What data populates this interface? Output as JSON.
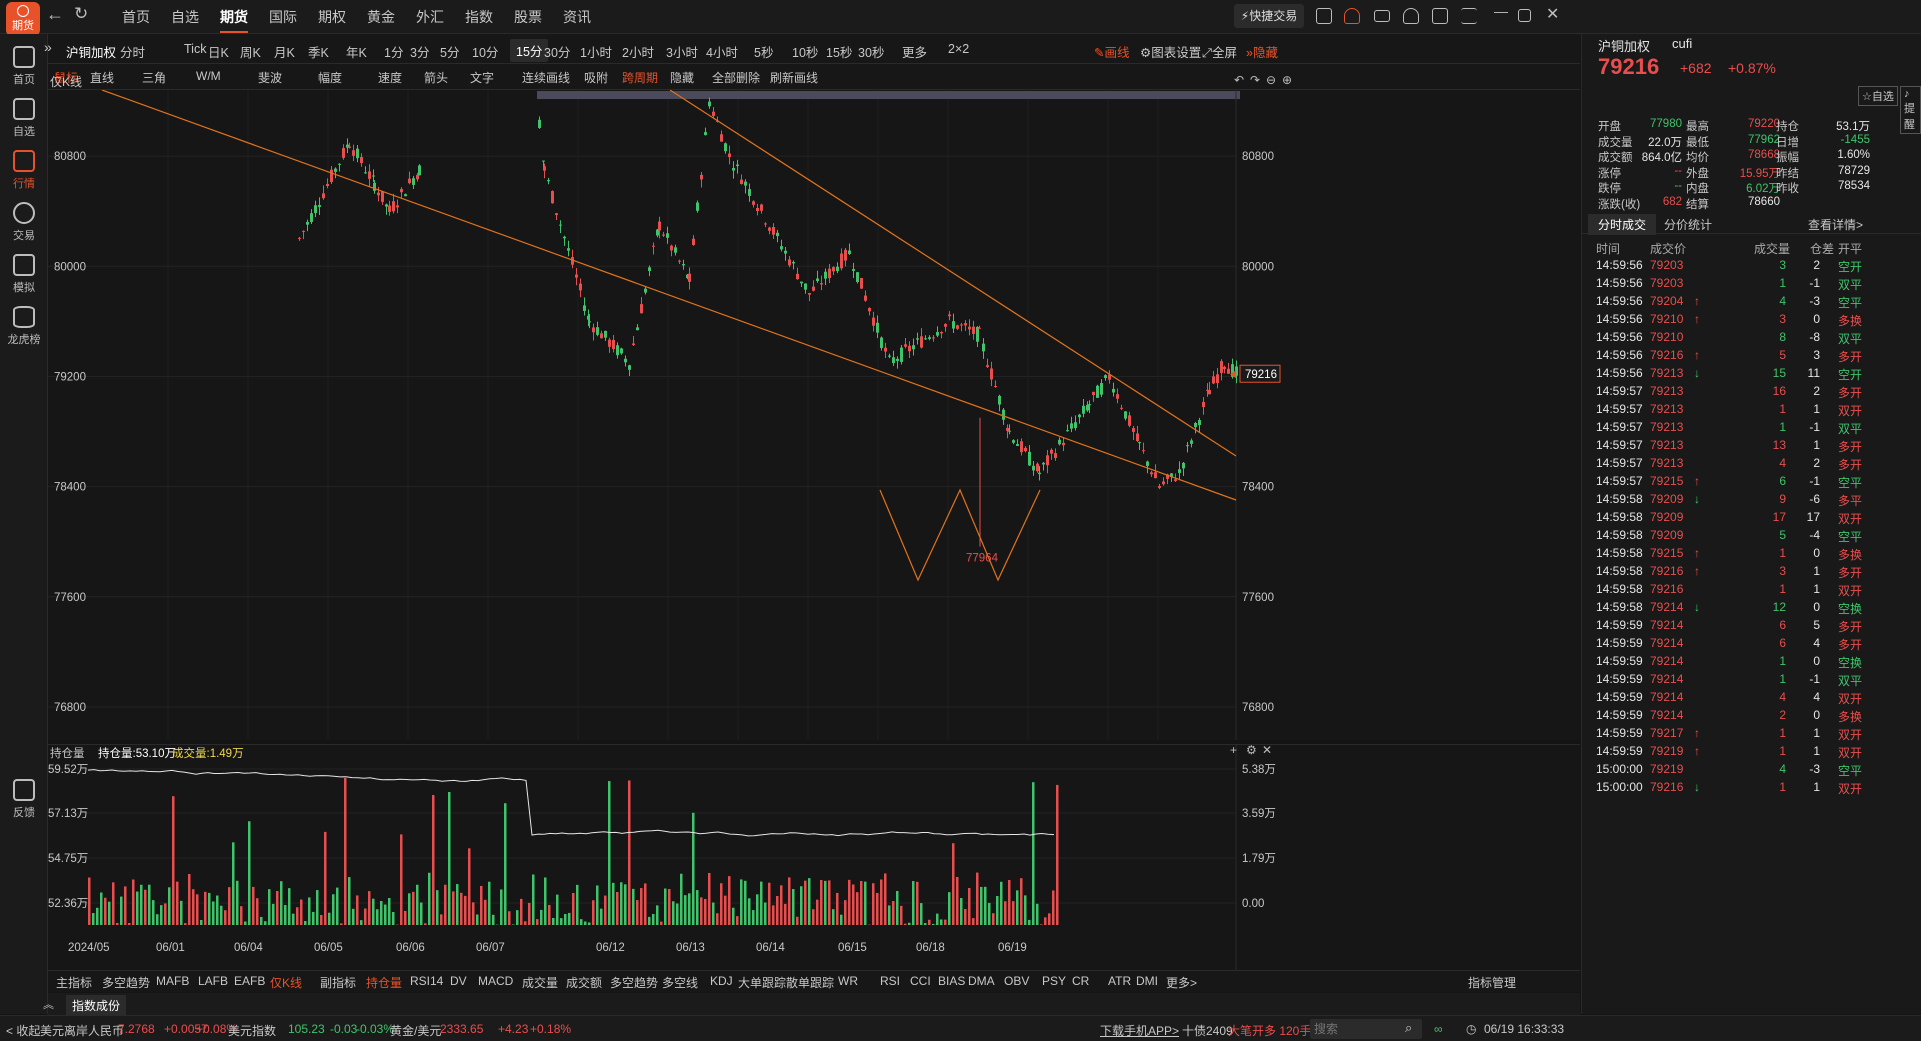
{
  "app": {
    "logo_text": "期货",
    "quick_trade": "快捷交易"
  },
  "nav": [
    "首页",
    "自选",
    "期货",
    "国际",
    "期权",
    "黄金",
    "外汇",
    "指数",
    "股票",
    "资讯"
  ],
  "nav_active": 2,
  "leftbar": [
    {
      "label": "首页",
      "icon": "home-grid-icon"
    },
    {
      "label": "自选",
      "icon": "watchlist-icon"
    },
    {
      "label": "行情",
      "icon": "market-chart-icon",
      "active": true
    },
    {
      "label": "交易",
      "icon": "yen-trade-icon"
    },
    {
      "label": "模拟",
      "icon": "gamepad-icon"
    },
    {
      "label": "龙虎榜",
      "icon": "database-icon"
    },
    {
      "label": "反馈",
      "icon": "feedback-icon"
    }
  ],
  "toolbar": {
    "symbol": "沪铜加权",
    "timeframes": [
      "分时",
      "Tick",
      "日K",
      "周K",
      "月K",
      "季K",
      "年K",
      "1分",
      "3分",
      "5分",
      "10分",
      "15分",
      "30分",
      "1小时",
      "2小时",
      "3小时",
      "4小时",
      "5秒",
      "10秒",
      "15秒",
      "30秒",
      "更多",
      "2×2"
    ],
    "active_tf": "15分",
    "draw": "画线",
    "chart_settings": "图表设置",
    "fullscreen": "全屏",
    "hide": "隐藏"
  },
  "drawtools": [
    "鼠标",
    "直线",
    "三角",
    "W/M",
    "斐波",
    "幅度",
    "速度",
    "箭头",
    "文字",
    "连续画线",
    "吸附",
    "跨周期",
    "隐藏",
    "全部删除",
    "刷新画线"
  ],
  "chart": {
    "indicator_label": "仅K线",
    "price_ticks": [
      "80800",
      "80000",
      "79200",
      "78400",
      "77600",
      "76800"
    ],
    "last_price_tag": "79216",
    "low_label": "77964"
  },
  "vol": {
    "header": "持仓量",
    "oi_label": "持仓量:53.10万",
    "vol_label": "成交量:1.49万",
    "left_ticks": [
      "59.52万",
      "57.13万",
      "54.75万",
      "52.36万"
    ],
    "right_ticks": [
      "5.38万",
      "3.59万",
      "1.79万",
      "0.00"
    ],
    "dates": [
      "2024/05",
      "06/01",
      "06/04",
      "06/05",
      "06/06",
      "06/07",
      "06/12",
      "06/13",
      "06/14",
      "06/15",
      "06/18",
      "06/19"
    ]
  },
  "indicators": {
    "main": "主指标",
    "sub": "副指标",
    "list_main": [
      "多空趋势",
      "MAFB",
      "LAFB",
      "EAFB",
      "仅K线"
    ],
    "list_sub": [
      "持仓量",
      "RSI14",
      "DV",
      "MACD",
      "成交量",
      "成交额",
      "多空趋势",
      "多空线",
      "KDJ",
      "大单跟踪",
      "散单跟踪",
      "WR",
      "RSI",
      "CCI",
      "BIAS",
      "DMA",
      "OBV",
      "PSY",
      "CR",
      "ATR",
      "DMI",
      "更多>"
    ],
    "manage": "指标管理",
    "tab": "指数成份"
  },
  "quote": {
    "name": "沪铜加权",
    "code": "cufi",
    "price": "79216",
    "change": "+682",
    "pct": "+0.87%",
    "btn_watch": "自选",
    "btn_alert": "提醒",
    "rows": [
      [
        [
          "开盘",
          "77980",
          "green"
        ],
        [
          "最高",
          "79220",
          "red"
        ],
        [
          "持仓",
          "53.1万",
          "white"
        ]
      ],
      [
        [
          "成交量",
          "22.0万",
          "white"
        ],
        [
          "最低",
          "77962",
          "green"
        ],
        [
          "日增",
          "-1455",
          "green"
        ]
      ],
      [
        [
          "成交额",
          "864.0亿",
          "white"
        ],
        [
          "均价",
          "78668",
          "red"
        ],
        [
          "振幅",
          "1.60%",
          "white"
        ]
      ],
      [
        [
          "涨停",
          "--",
          "red"
        ],
        [
          "外盘",
          "15.95万",
          "red"
        ],
        [
          "昨结",
          "78729",
          "white"
        ]
      ],
      [
        [
          "跌停",
          "--",
          "green"
        ],
        [
          "内盘",
          "6.02万",
          "green"
        ],
        [
          "昨收",
          "78534",
          "white"
        ]
      ],
      [
        [
          "涨跌(收)",
          "682",
          "red"
        ],
        [
          "结算",
          "78660",
          "white"
        ]
      ]
    ]
  },
  "trades": {
    "tabs": [
      "分时成交",
      "分价统计"
    ],
    "detail": "查看详情>",
    "headers": [
      "时间",
      "成交价",
      "成交量",
      "仓差",
      "开平"
    ],
    "rows": [
      [
        "14:59:56",
        "79203",
        "",
        "3",
        "2",
        "空开"
      ],
      [
        "14:59:56",
        "79203",
        "",
        "1",
        "-1",
        "双平"
      ],
      [
        "14:59:56",
        "79204",
        "↑",
        "4",
        "-3",
        "空平"
      ],
      [
        "14:59:56",
        "79210",
        "↑",
        "3",
        "0",
        "多换"
      ],
      [
        "14:59:56",
        "79210",
        "",
        "8",
        "-8",
        "双平"
      ],
      [
        "14:59:56",
        "79216",
        "↑",
        "5",
        "3",
        "多开"
      ],
      [
        "14:59:56",
        "79213",
        "↓",
        "15",
        "11",
        "空开"
      ],
      [
        "14:59:57",
        "79213",
        "",
        "16",
        "2",
        "多开"
      ],
      [
        "14:59:57",
        "79213",
        "",
        "1",
        "1",
        "双开"
      ],
      [
        "14:59:57",
        "79213",
        "",
        "1",
        "-1",
        "双平"
      ],
      [
        "14:59:57",
        "79213",
        "",
        "13",
        "1",
        "多开"
      ],
      [
        "14:59:57",
        "79213",
        "",
        "4",
        "2",
        "多开"
      ],
      [
        "14:59:57",
        "79215",
        "↑",
        "6",
        "-1",
        "空平"
      ],
      [
        "14:59:58",
        "79209",
        "↓",
        "9",
        "-6",
        "多平"
      ],
      [
        "14:59:58",
        "79209",
        "",
        "17",
        "17",
        "双开"
      ],
      [
        "14:59:58",
        "79209",
        "",
        "5",
        "-4",
        "空平"
      ],
      [
        "14:59:58",
        "79215",
        "↑",
        "1",
        "0",
        "多换"
      ],
      [
        "14:59:58",
        "79216",
        "↑",
        "3",
        "1",
        "多开"
      ],
      [
        "14:59:58",
        "79216",
        "",
        "1",
        "1",
        "双开"
      ],
      [
        "14:59:58",
        "79214",
        "↓",
        "12",
        "0",
        "空换"
      ],
      [
        "14:59:59",
        "79214",
        "",
        "6",
        "5",
        "多开"
      ],
      [
        "14:59:59",
        "79214",
        "",
        "6",
        "4",
        "多开"
      ],
      [
        "14:59:59",
        "79214",
        "",
        "1",
        "0",
        "空换"
      ],
      [
        "14:59:59",
        "79214",
        "",
        "1",
        "-1",
        "双平"
      ],
      [
        "14:59:59",
        "79214",
        "",
        "4",
        "4",
        "双开"
      ],
      [
        "14:59:59",
        "79214",
        "",
        "2",
        "0",
        "多换"
      ],
      [
        "14:59:59",
        "79217",
        "↑",
        "1",
        "1",
        "双开"
      ],
      [
        "14:59:59",
        "79219",
        "↑",
        "1",
        "1",
        "双开"
      ],
      [
        "15:00:00",
        "79219",
        "",
        "4",
        "-3",
        "空平"
      ],
      [
        "15:00:00",
        "79216",
        "↓",
        "1",
        "1",
        "双开"
      ]
    ]
  },
  "bottom": {
    "collapse": "< 收起",
    "tickers": [
      {
        "name": "美元离岸人民币",
        "price": "7.2768",
        "chg": "+0.0057",
        "pct": "+0.08%",
        "color": "red"
      },
      {
        "name": "美元指数",
        "price": "105.23",
        "chg": "-0.03",
        "pct": "-0.03%",
        "color": "green"
      },
      {
        "name": "黄金/美元",
        "price": "2333.65",
        "chg": "+4.23",
        "pct": "+0.18%",
        "color": "red"
      }
    ],
    "download": "下载手机APP>",
    "news": "十债2409",
    "news_hl": "大笔开多 120手",
    "search_placeholder": "搜索",
    "datetime": "06/19 16:33:33"
  },
  "colors": {
    "up": "#e94e4e",
    "down": "#3fc46b",
    "accent": "#e8522a",
    "trend": "#e0731f"
  }
}
